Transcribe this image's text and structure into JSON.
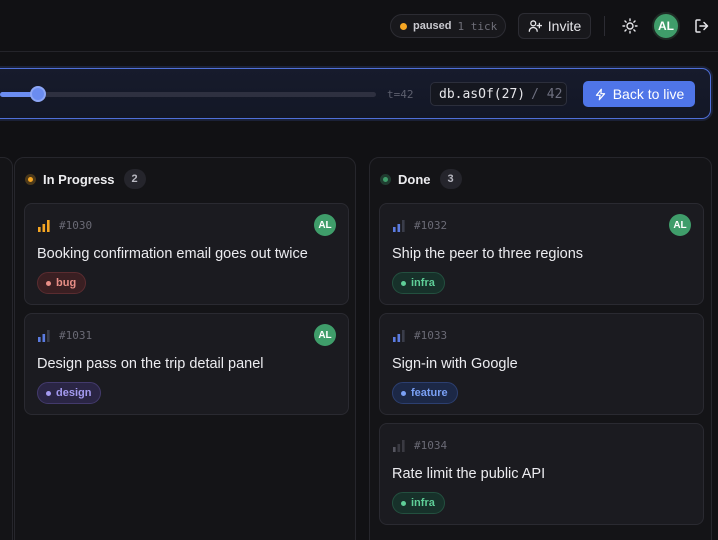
{
  "header": {
    "status": {
      "label": "paused",
      "sub": "1 tick",
      "dot_color": "#f5a623"
    },
    "invite_label": "Invite",
    "avatar_initials": "AL",
    "icons": [
      "user-plus-icon",
      "sun-icon",
      "logout-icon"
    ]
  },
  "timebar": {
    "position_fraction": 0.09,
    "tick_label": "t=42",
    "asof_expr": "db.asOf(27)",
    "asof_total": "/ 42",
    "live_button_label": "Back to live"
  },
  "columns": [
    {
      "name": "In Progress",
      "count": "2",
      "color": "#f5a623",
      "cards": [
        {
          "id": "#1030",
          "title": "Booking confirmation email goes out twice",
          "tag": "bug",
          "tag_style": "bug",
          "priority": "high",
          "assignee": "AL"
        },
        {
          "id": "#1031",
          "title": "Design pass on the trip detail panel",
          "tag": "design",
          "tag_style": "design",
          "priority": "medium",
          "assignee": "AL"
        }
      ]
    },
    {
      "name": "Done",
      "count": "3",
      "color": "#3f9d6a",
      "cards": [
        {
          "id": "#1032",
          "title": "Ship the peer to three regions",
          "tag": "infra",
          "tag_style": "infra",
          "priority": "medium",
          "assignee": "AL"
        },
        {
          "id": "#1033",
          "title": "Sign-in with Google",
          "tag": "feature",
          "tag_style": "feature",
          "priority": "medium",
          "assignee": null
        },
        {
          "id": "#1034",
          "title": "Rate limit the public API",
          "tag": "infra",
          "tag_style": "infra",
          "priority": "low",
          "assignee": null
        }
      ]
    }
  ],
  "colors": {
    "accent": "#4f75e8",
    "priority_high": "#f5a623",
    "priority_medium": "#5b7be0",
    "priority_low": "#55555f"
  }
}
